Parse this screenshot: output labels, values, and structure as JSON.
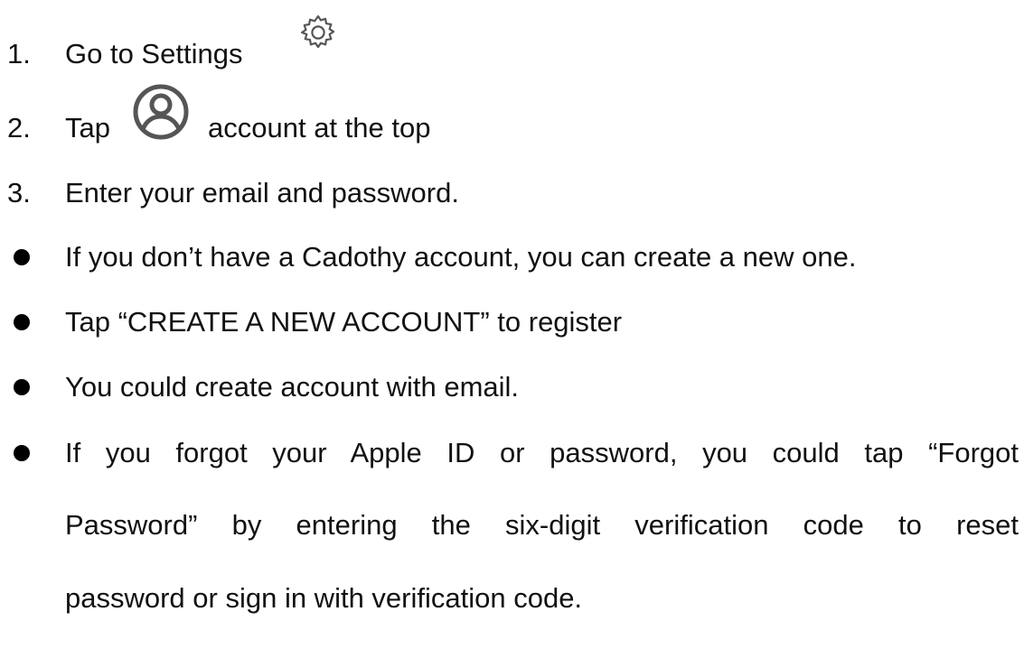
{
  "steps": [
    {
      "number": "1.",
      "text": "Go to Settings",
      "icon": "gear-icon"
    },
    {
      "number": "2.",
      "text_before": "Tap",
      "icon": "account-icon",
      "text_after": "account at the top"
    },
    {
      "number": "3.",
      "text": "Enter your email and password."
    }
  ],
  "bullets": [
    {
      "text": "If you don’t have a Cadothy account, you can create a new one."
    },
    {
      "text": "Tap “CREATE A NEW ACCOUNT” to register"
    },
    {
      "text": "You could create account with email."
    },
    {
      "lines": [
        "If you forgot your Apple ID or password, you could tap “Forgot",
        "Password” by entering the six-digit verification code to reset",
        "password or sign in with verification code."
      ]
    }
  ],
  "colors": {
    "text": "#111111",
    "icon": "#555555"
  }
}
